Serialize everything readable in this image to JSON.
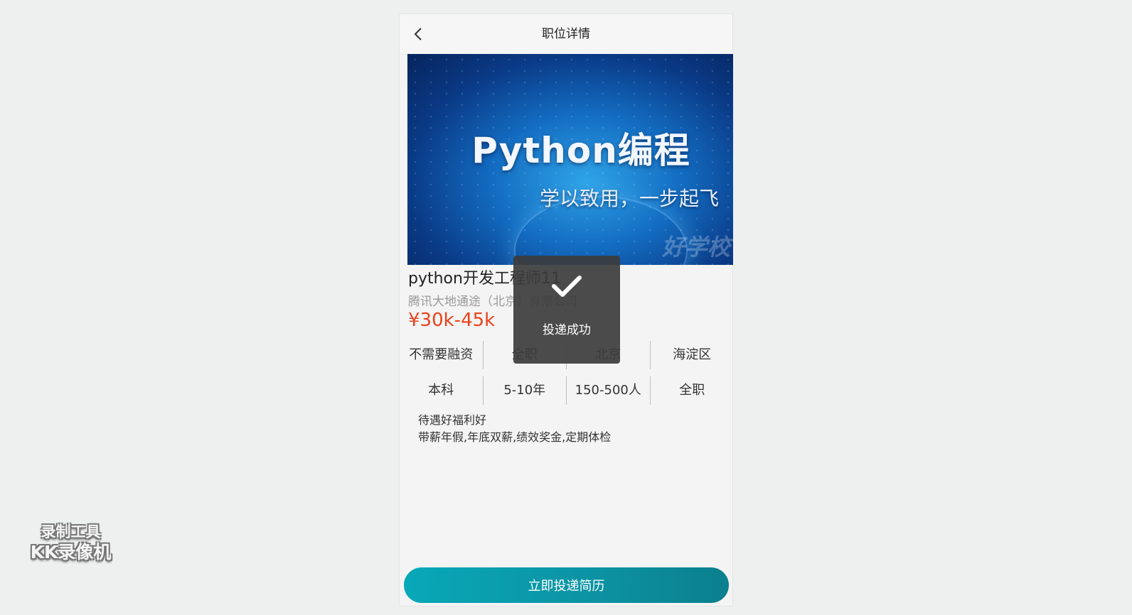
{
  "header": {
    "title": "职位详情",
    "back_icon": "chevron-left-icon"
  },
  "banner": {
    "title": "Python编程",
    "subtitle": "学以致用，一步起飞",
    "watermark": "好学校"
  },
  "job": {
    "title": "python开发工程师11",
    "company": "腾讯大地通途（北京）有限公司",
    "salary": "¥30k-45k",
    "tags_row1": [
      "不需要融资",
      "全职",
      "北京",
      "海淀区"
    ],
    "tags_row2": [
      "本科",
      "5-10年",
      "150-500人",
      "全职"
    ],
    "desc_line1": "待遇好福利好",
    "desc_line2": "带薪年假,年底双薪,绩效奖金,定期体检"
  },
  "apply_button": {
    "label": "立即投递简历"
  },
  "toast": {
    "text": "投递成功",
    "icon": "checkmark-icon"
  },
  "watermark_logo": {
    "line1": "录制工具",
    "line2": "KK录像机"
  },
  "colors": {
    "salary": "#e9431e",
    "button_start": "#08a8b8",
    "button_end": "#0b7f8d"
  }
}
